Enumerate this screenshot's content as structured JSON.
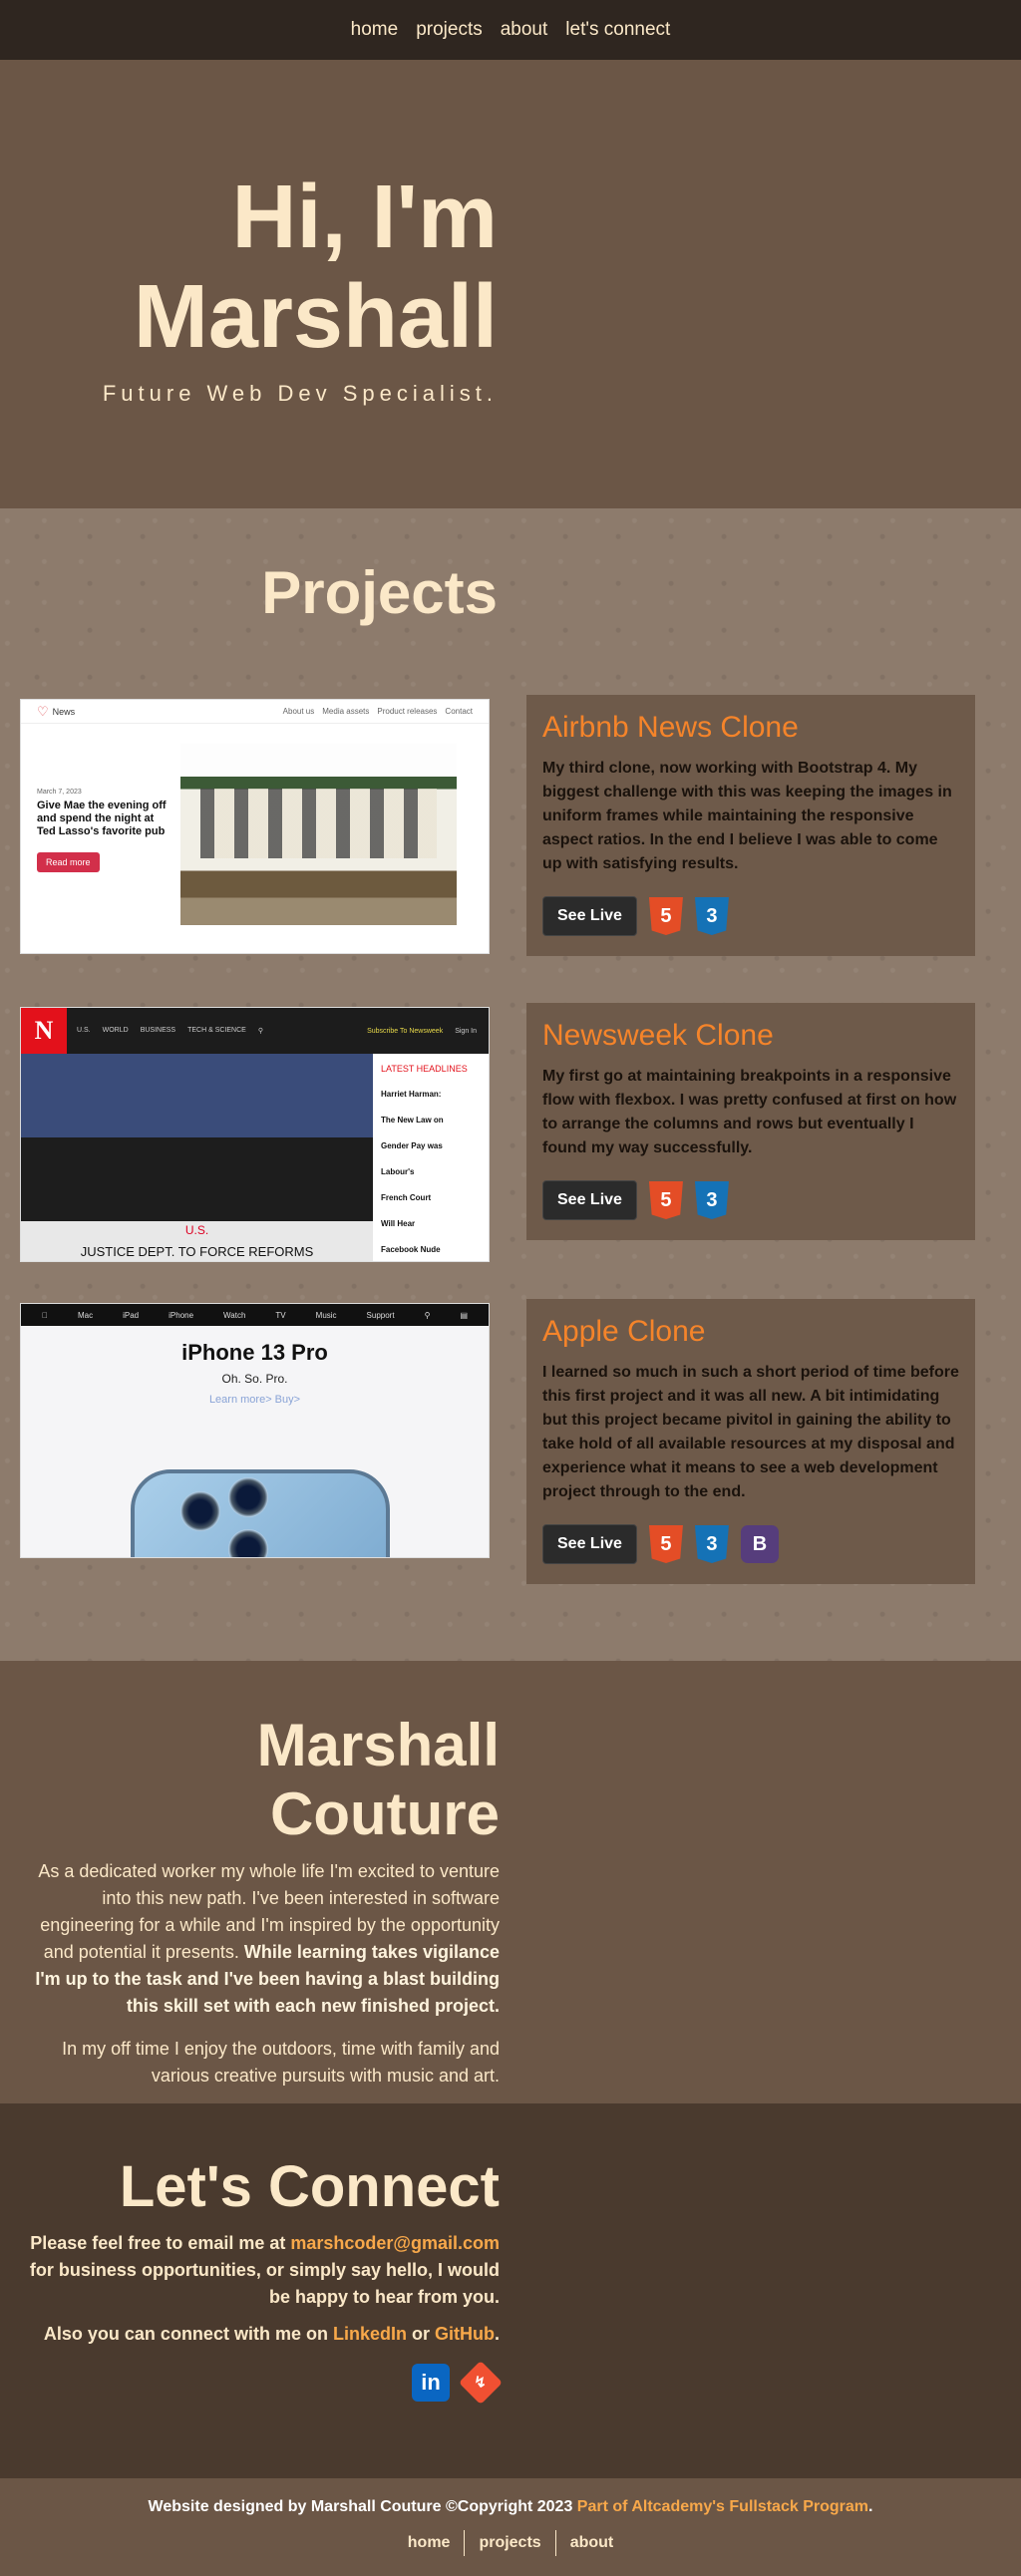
{
  "nav": {
    "items": [
      "home",
      "projects",
      "about",
      "let's connect"
    ]
  },
  "hero": {
    "title_line1": "Hi, I'm",
    "title_line2": "Marshall",
    "tagline": "Future Web Dev Specialist."
  },
  "projects": {
    "heading": "Projects",
    "see_live_label": "See Live",
    "items": [
      {
        "title": "Airbnb News Clone",
        "description": "My third clone, now working with Bootstrap 4. My biggest challenge with this was keeping the images in uniform frames while maintaining the responsive aspect ratios. In the end I believe I was able to come up with satisfying results.",
        "tech": [
          "html5-icon",
          "css3-icon"
        ],
        "screenshot": {
          "brand": "News",
          "links": [
            "About us",
            "Media assets",
            "Product releases",
            "Contact"
          ],
          "date": "March 7, 2023",
          "headline": "Give Mae the evening off and spend the night at Ted Lasso's favorite pub",
          "button": "Read more"
        }
      },
      {
        "title": "Newsweek Clone",
        "description": "My first go at maintaining breakpoints in a responsive flow with flexbox. I was pretty confused at first on how to arrange the columns and rows but eventually I found my way successfully.",
        "tech": [
          "html5-icon",
          "css3-icon"
        ],
        "screenshot": {
          "logo": "N",
          "links": [
            "U.S.",
            "WORLD",
            "BUSINESS",
            "TECH & SCIENCE"
          ],
          "subscribe": "Subscribe To Newsweek",
          "signin": "Sign In",
          "category": "U.S.",
          "headline": "JUSTICE DEPT. TO FORCE REFORMS",
          "latest": "LATEST HEADLINES",
          "side_items": [
            "Harriet Harman:",
            "The New Law on",
            "Gender Pay was",
            "Labour's",
            "French Court",
            "Will Hear",
            "Facebook Nude"
          ]
        }
      },
      {
        "title": "Apple Clone",
        "description": "I learned so much in such a short period of time before this first project and it was all new. A bit intimidating but this project became pivitol in gaining the ability to take hold of all available resources at my disposal and experience what it means to see a web development project through to the end.",
        "tech": [
          "html5-icon",
          "css3-icon",
          "bootstrap-icon"
        ],
        "screenshot": {
          "links": [
            "Mac",
            "iPad",
            "iPhone",
            "Watch",
            "TV",
            "Music",
            "Support"
          ],
          "title": "iPhone 13 Pro",
          "subtitle": "Oh. So. Pro.",
          "cta": "Learn more>   Buy>"
        }
      }
    ]
  },
  "about": {
    "heading": "Marshall Couture",
    "para1_normal": "As a dedicated worker my whole life I'm excited to venture into this new path. I've been interested in software engineering for a while and I'm inspired by the opportunity and potential it presents. ",
    "para1_bold": "While learning takes vigilance I'm up to the task and I've been having a blast building this skill set with each new finished project.",
    "para2": "In my off time I enjoy the outdoors, time with family and various creative pursuits with music and art."
  },
  "connect": {
    "heading": "Let's Connect",
    "line1_prefix": "Please feel free to email me at ",
    "email": "marshcoder@gmail.com",
    "line1_suffix": " for business opportunities, or simply say hello, I would be happy to hear from you.",
    "line2_prefix": "Also you can connect with me on ",
    "linkedin": "LinkedIn",
    "or": " or ",
    "github": "GitHub",
    "line2_suffix": "."
  },
  "footer": {
    "copy": "Website designed by Marshall Couture ©Copyright 2023 ",
    "link": "Part of Altcademy's Fullstack Program",
    "period": ".",
    "nav": [
      "home",
      "projects",
      "about"
    ]
  },
  "colors": {
    "accent": "#f5842a",
    "link": "#f8a84a",
    "cream": "#fbe8c8",
    "nav_bg": "#2f2620"
  }
}
